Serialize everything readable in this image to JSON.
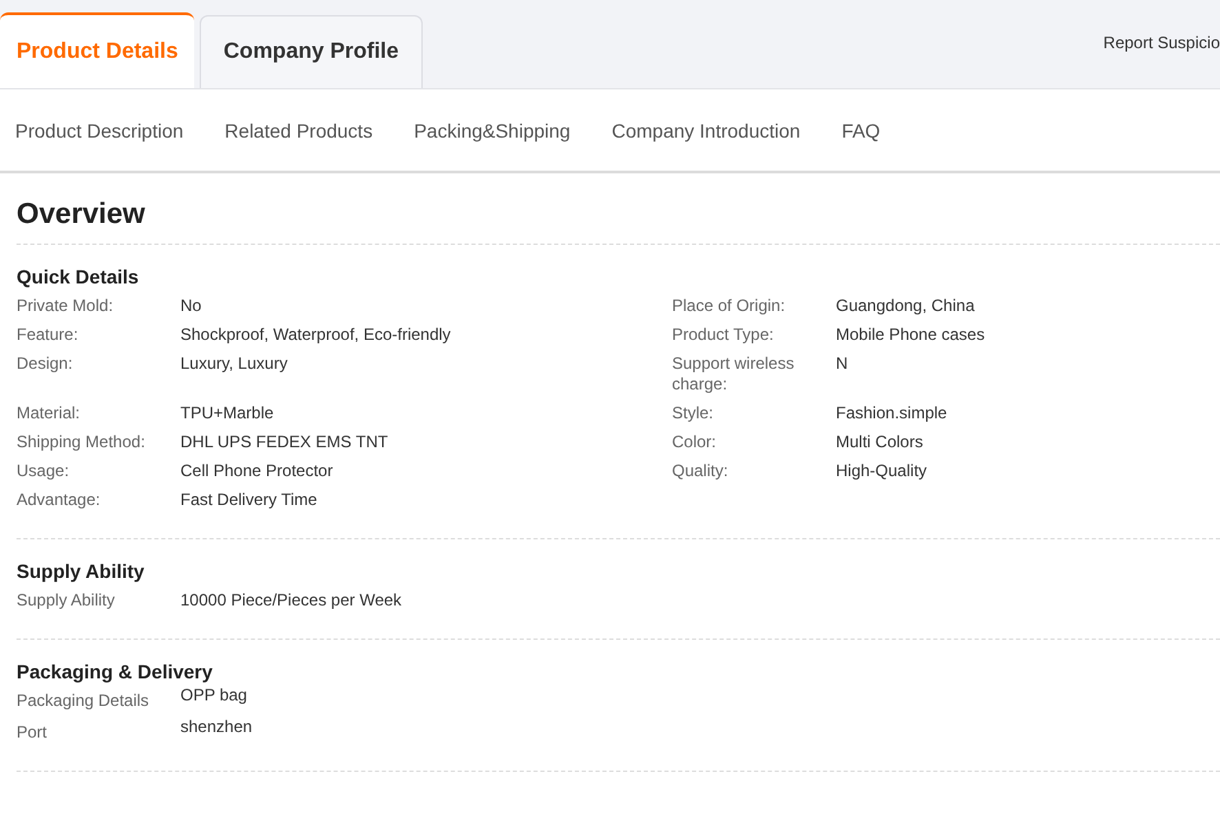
{
  "tabs": [
    {
      "label": "Product Details",
      "selected": true
    },
    {
      "label": "Company Profile",
      "selected": false
    }
  ],
  "report_link": "Report Suspicio",
  "nav_links": [
    "Product Description",
    "Related Products",
    "Packing&Shipping",
    "Company Introduction",
    "FAQ"
  ],
  "overview": {
    "title": "Overview",
    "quick_details": {
      "title": "Quick Details",
      "left": [
        {
          "label": "Private Mold:",
          "value": "No"
        },
        {
          "label": "Feature:",
          "value": "Shockproof, Waterproof, Eco-friendly"
        },
        {
          "label": "Design:",
          "value": "Luxury, Luxury"
        },
        {
          "label": "Material:",
          "value": "TPU+Marble"
        },
        {
          "label": "Shipping Method:",
          "value": "DHL UPS FEDEX EMS TNT"
        },
        {
          "label": "Usage:",
          "value": "Cell Phone Protector"
        },
        {
          "label": "Advantage:",
          "value": "Fast Delivery Time"
        }
      ],
      "right": [
        {
          "label": "Place of Origin:",
          "value": "Guangdong, China"
        },
        {
          "label": "Product Type:",
          "value": "Mobile Phone cases"
        },
        {
          "label": "Support wireless charge:",
          "value": "N"
        },
        {
          "label": "Style:",
          "value": "Fashion.simple"
        },
        {
          "label": "Color:",
          "value": "Multi Colors"
        },
        {
          "label": "Quality:",
          "value": "High-Quality"
        }
      ]
    },
    "sections": [
      {
        "title": "Supply Ability",
        "rows": [
          {
            "label": "Supply Ability",
            "value": "10000 Piece/Pieces per Week"
          }
        ]
      },
      {
        "title": "Packaging & Delivery",
        "rows": [
          {
            "label": "Packaging Details",
            "value": "OPP bag"
          },
          {
            "label": "Port",
            "value": "shenzhen"
          }
        ]
      }
    ]
  }
}
